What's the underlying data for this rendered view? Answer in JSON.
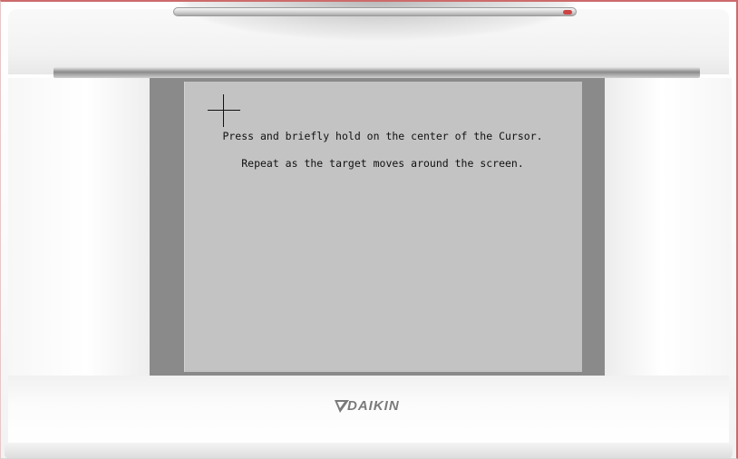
{
  "screen": {
    "instruction_line1": "Press and briefly hold on the center of the Cursor.",
    "instruction_line2": "Repeat as the target moves around the screen.",
    "cursor_icon": "crosshair-target-icon"
  },
  "device": {
    "brand": "DAIKIN",
    "logo_icon": "daikin-triangle-icon",
    "colors": {
      "shell": "#ffffff",
      "bezel": "#8a8a8a",
      "screen_bg": "#c3c3c3",
      "logo": "#7a7a7a",
      "accent_edge": "#cc6b6b"
    }
  }
}
